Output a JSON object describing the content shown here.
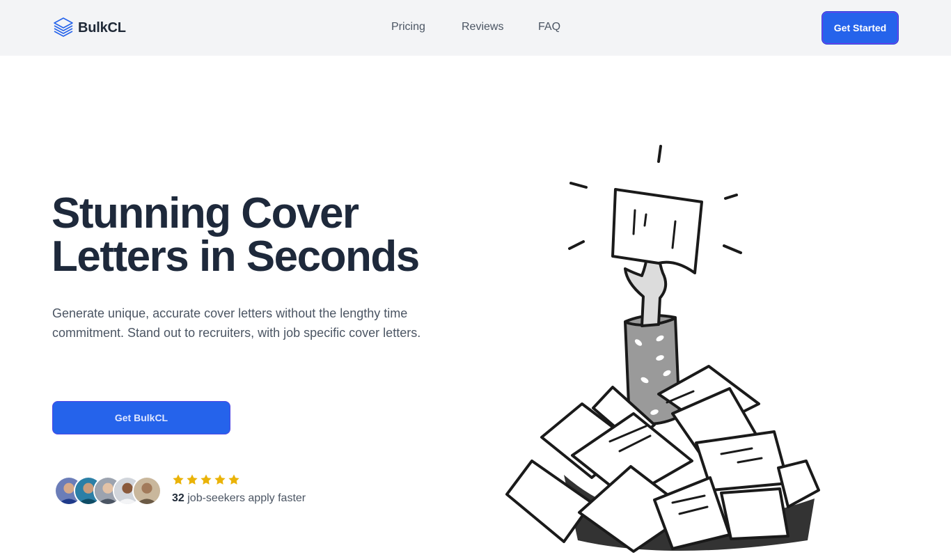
{
  "brand": {
    "name": "BulkCL",
    "logo_icon": "layers-stack-icon",
    "color": "#2563eb"
  },
  "nav": {
    "links": [
      {
        "label": "Pricing"
      },
      {
        "label": "Reviews"
      },
      {
        "label": "FAQ"
      }
    ],
    "cta_label": "Get Started"
  },
  "hero": {
    "headline_line1": "Stunning Cover",
    "headline_line2": "Letters in Seconds",
    "subtitle": "Generate unique, accurate cover letters without the lengthy time commitment. Stand out to recruiters, with job specific cover letters.",
    "cta_label": "Get BulkCL"
  },
  "social_proof": {
    "avatars": [
      "user-avatar-1",
      "user-avatar-2",
      "user-avatar-3",
      "user-avatar-4",
      "user-avatar-5"
    ],
    "stars": 5,
    "count": "32",
    "count_suffix": "job-seekers apply faster",
    "star_color": "#eab308"
  },
  "illustration": {
    "icon": "hand-holding-paper-from-paper-pile-icon"
  },
  "colors": {
    "accent": "#2563eb",
    "heading": "#1e293b",
    "body_text": "#4b5563",
    "navbar_bg": "#f3f4f6"
  }
}
